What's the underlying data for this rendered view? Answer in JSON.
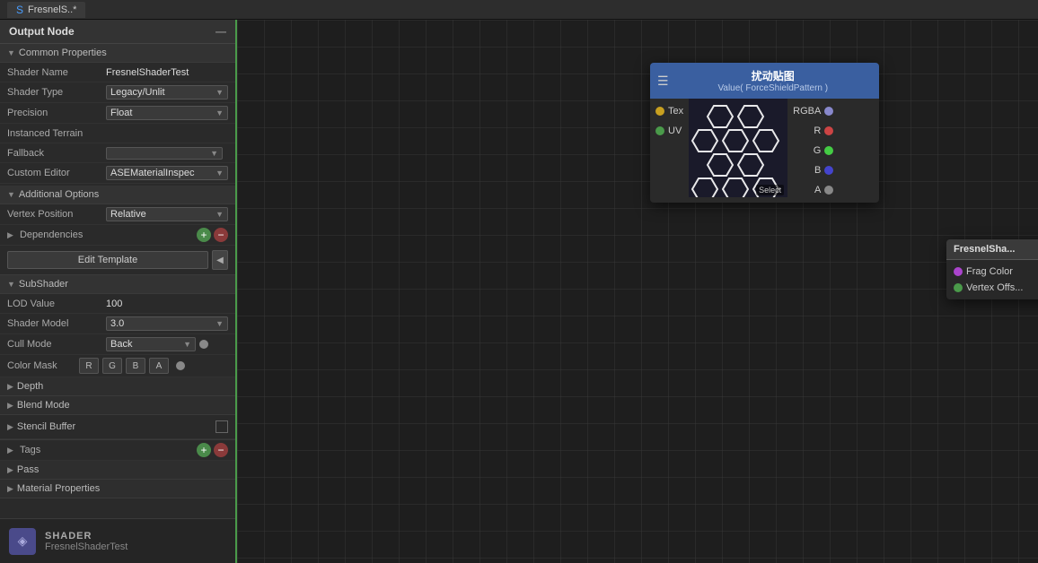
{
  "titlebar": {
    "tab_label": "FresnelS..*",
    "tab_icon": "S"
  },
  "header": {
    "output_node_label": "Output Node",
    "collapse_icon": "—"
  },
  "toolbar": {
    "title": "FresnelShaderTest",
    "btn_yellow_label": "●",
    "btn_gray_label": "●",
    "btn_doc_label": "▤"
  },
  "common_properties": {
    "section_label": "Common Properties",
    "shader_name_label": "Shader Name",
    "shader_name_value": "FresnelShaderTest",
    "shader_type_label": "Shader Type",
    "shader_type_value": "Legacy/Unlit",
    "precision_label": "Precision",
    "precision_value": "Float",
    "instanced_terrain_label": "Instanced Terrain",
    "fallback_label": "Fallback",
    "custom_editor_label": "Custom Editor",
    "custom_editor_value": "ASEMaterialInspec"
  },
  "additional_options": {
    "section_label": "Additional Options",
    "vertex_position_label": "Vertex Position",
    "vertex_position_value": "Relative"
  },
  "dependencies": {
    "section_label": "Dependencies"
  },
  "edit_template": {
    "btn_label": "Edit Template",
    "arrow_label": "◀"
  },
  "subshader": {
    "section_label": "SubShader",
    "lod_value_label": "LOD Value",
    "lod_value": "100",
    "shader_model_label": "Shader Model",
    "shader_model_value": "3.0",
    "cull_mode_label": "Cull Mode",
    "cull_mode_value": "Back",
    "color_mask_label": "Color Mask",
    "color_mask_r": "R",
    "color_mask_g": "G",
    "color_mask_b": "B",
    "color_mask_a": "A"
  },
  "collapsibles": {
    "depth_label": "Depth",
    "blend_mode_label": "Blend Mode",
    "stencil_buffer_label": "Stencil Buffer",
    "tags_label": "Tags"
  },
  "pass_label": "Pass",
  "material_properties_label": "Material Properties",
  "bottom": {
    "shader_type": "SHADER",
    "shader_name": "FresnelShaderTest",
    "icon": "◈"
  },
  "texture_node": {
    "title": "扰动贴图",
    "subtitle": "Value( ForceShieldPattern )",
    "port_tex": "Tex",
    "port_uv": "UV",
    "port_rgba": "RGBA",
    "port_r": "R",
    "port_g": "G",
    "port_b": "B",
    "port_a": "A",
    "texture_label": "Select"
  },
  "fresnel_node": {
    "title": "FresnelSha...",
    "port_frag_color": "Frag Color",
    "port_vertex_off": "Vertex Offs..."
  }
}
